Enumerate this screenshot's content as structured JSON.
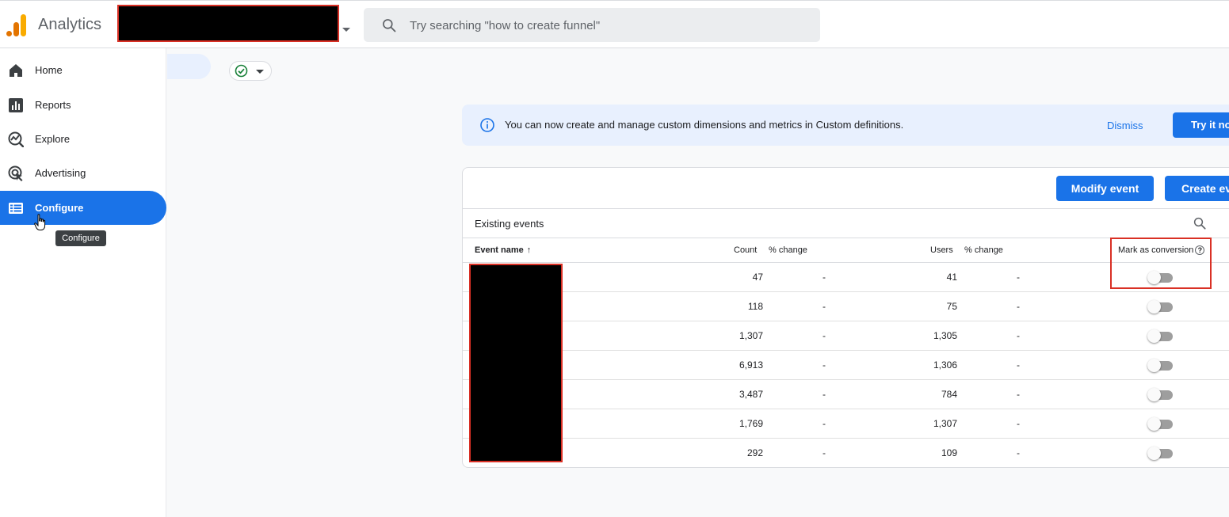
{
  "header": {
    "app_title": "Analytics",
    "search_placeholder": "Try searching \"how to create funnel\"",
    "icons": {
      "logo": "analytics-logo",
      "search": "search-icon",
      "account_dropdown": "chevron-down-icon"
    },
    "redacted_account": "redacted"
  },
  "sidebar": {
    "items": [
      {
        "label": "Home",
        "icon": "home-icon",
        "active": false
      },
      {
        "label": "Reports",
        "icon": "bar-chart-icon",
        "active": false
      },
      {
        "label": "Explore",
        "icon": "explore-icon",
        "active": false
      },
      {
        "label": "Advertising",
        "icon": "advertising-icon",
        "active": false
      },
      {
        "label": "Configure",
        "icon": "configure-icon",
        "active": true
      }
    ],
    "tooltip": "Configure"
  },
  "banner": {
    "text": "You can now create and manage custom dimensions and metrics in Custom definitions.",
    "dismiss_label": "Dismiss",
    "try_label": "Try it now"
  },
  "events_card": {
    "modify_label": "Modify event",
    "create_label": "Create event",
    "existing_label": "Existing events",
    "columns": {
      "event_name": "Event name",
      "count": "Count",
      "count_change": "% change",
      "users": "Users",
      "users_change": "% change",
      "conversion": "Mark as conversion"
    },
    "rows": [
      {
        "count": "47",
        "count_change": "-",
        "users": "41",
        "users_change": "-",
        "conversion": false
      },
      {
        "count": "118",
        "count_change": "-",
        "users": "75",
        "users_change": "-",
        "conversion": false
      },
      {
        "count": "1,307",
        "count_change": "-",
        "users": "1,305",
        "users_change": "-",
        "conversion": false
      },
      {
        "count": "6,913",
        "count_change": "-",
        "users": "1,306",
        "users_change": "-",
        "conversion": false
      },
      {
        "count": "3,487",
        "count_change": "-",
        "users": "784",
        "users_change": "-",
        "conversion": false
      },
      {
        "count": "1,769",
        "count_change": "-",
        "users": "1,307",
        "users_change": "-",
        "conversion": false
      },
      {
        "count": "292",
        "count_change": "-",
        "users": "109",
        "users_change": "-",
        "conversion": false
      }
    ]
  },
  "colors": {
    "primary": "#1a73e8",
    "highlight": "#d93025",
    "active_text": "#ffffff"
  }
}
